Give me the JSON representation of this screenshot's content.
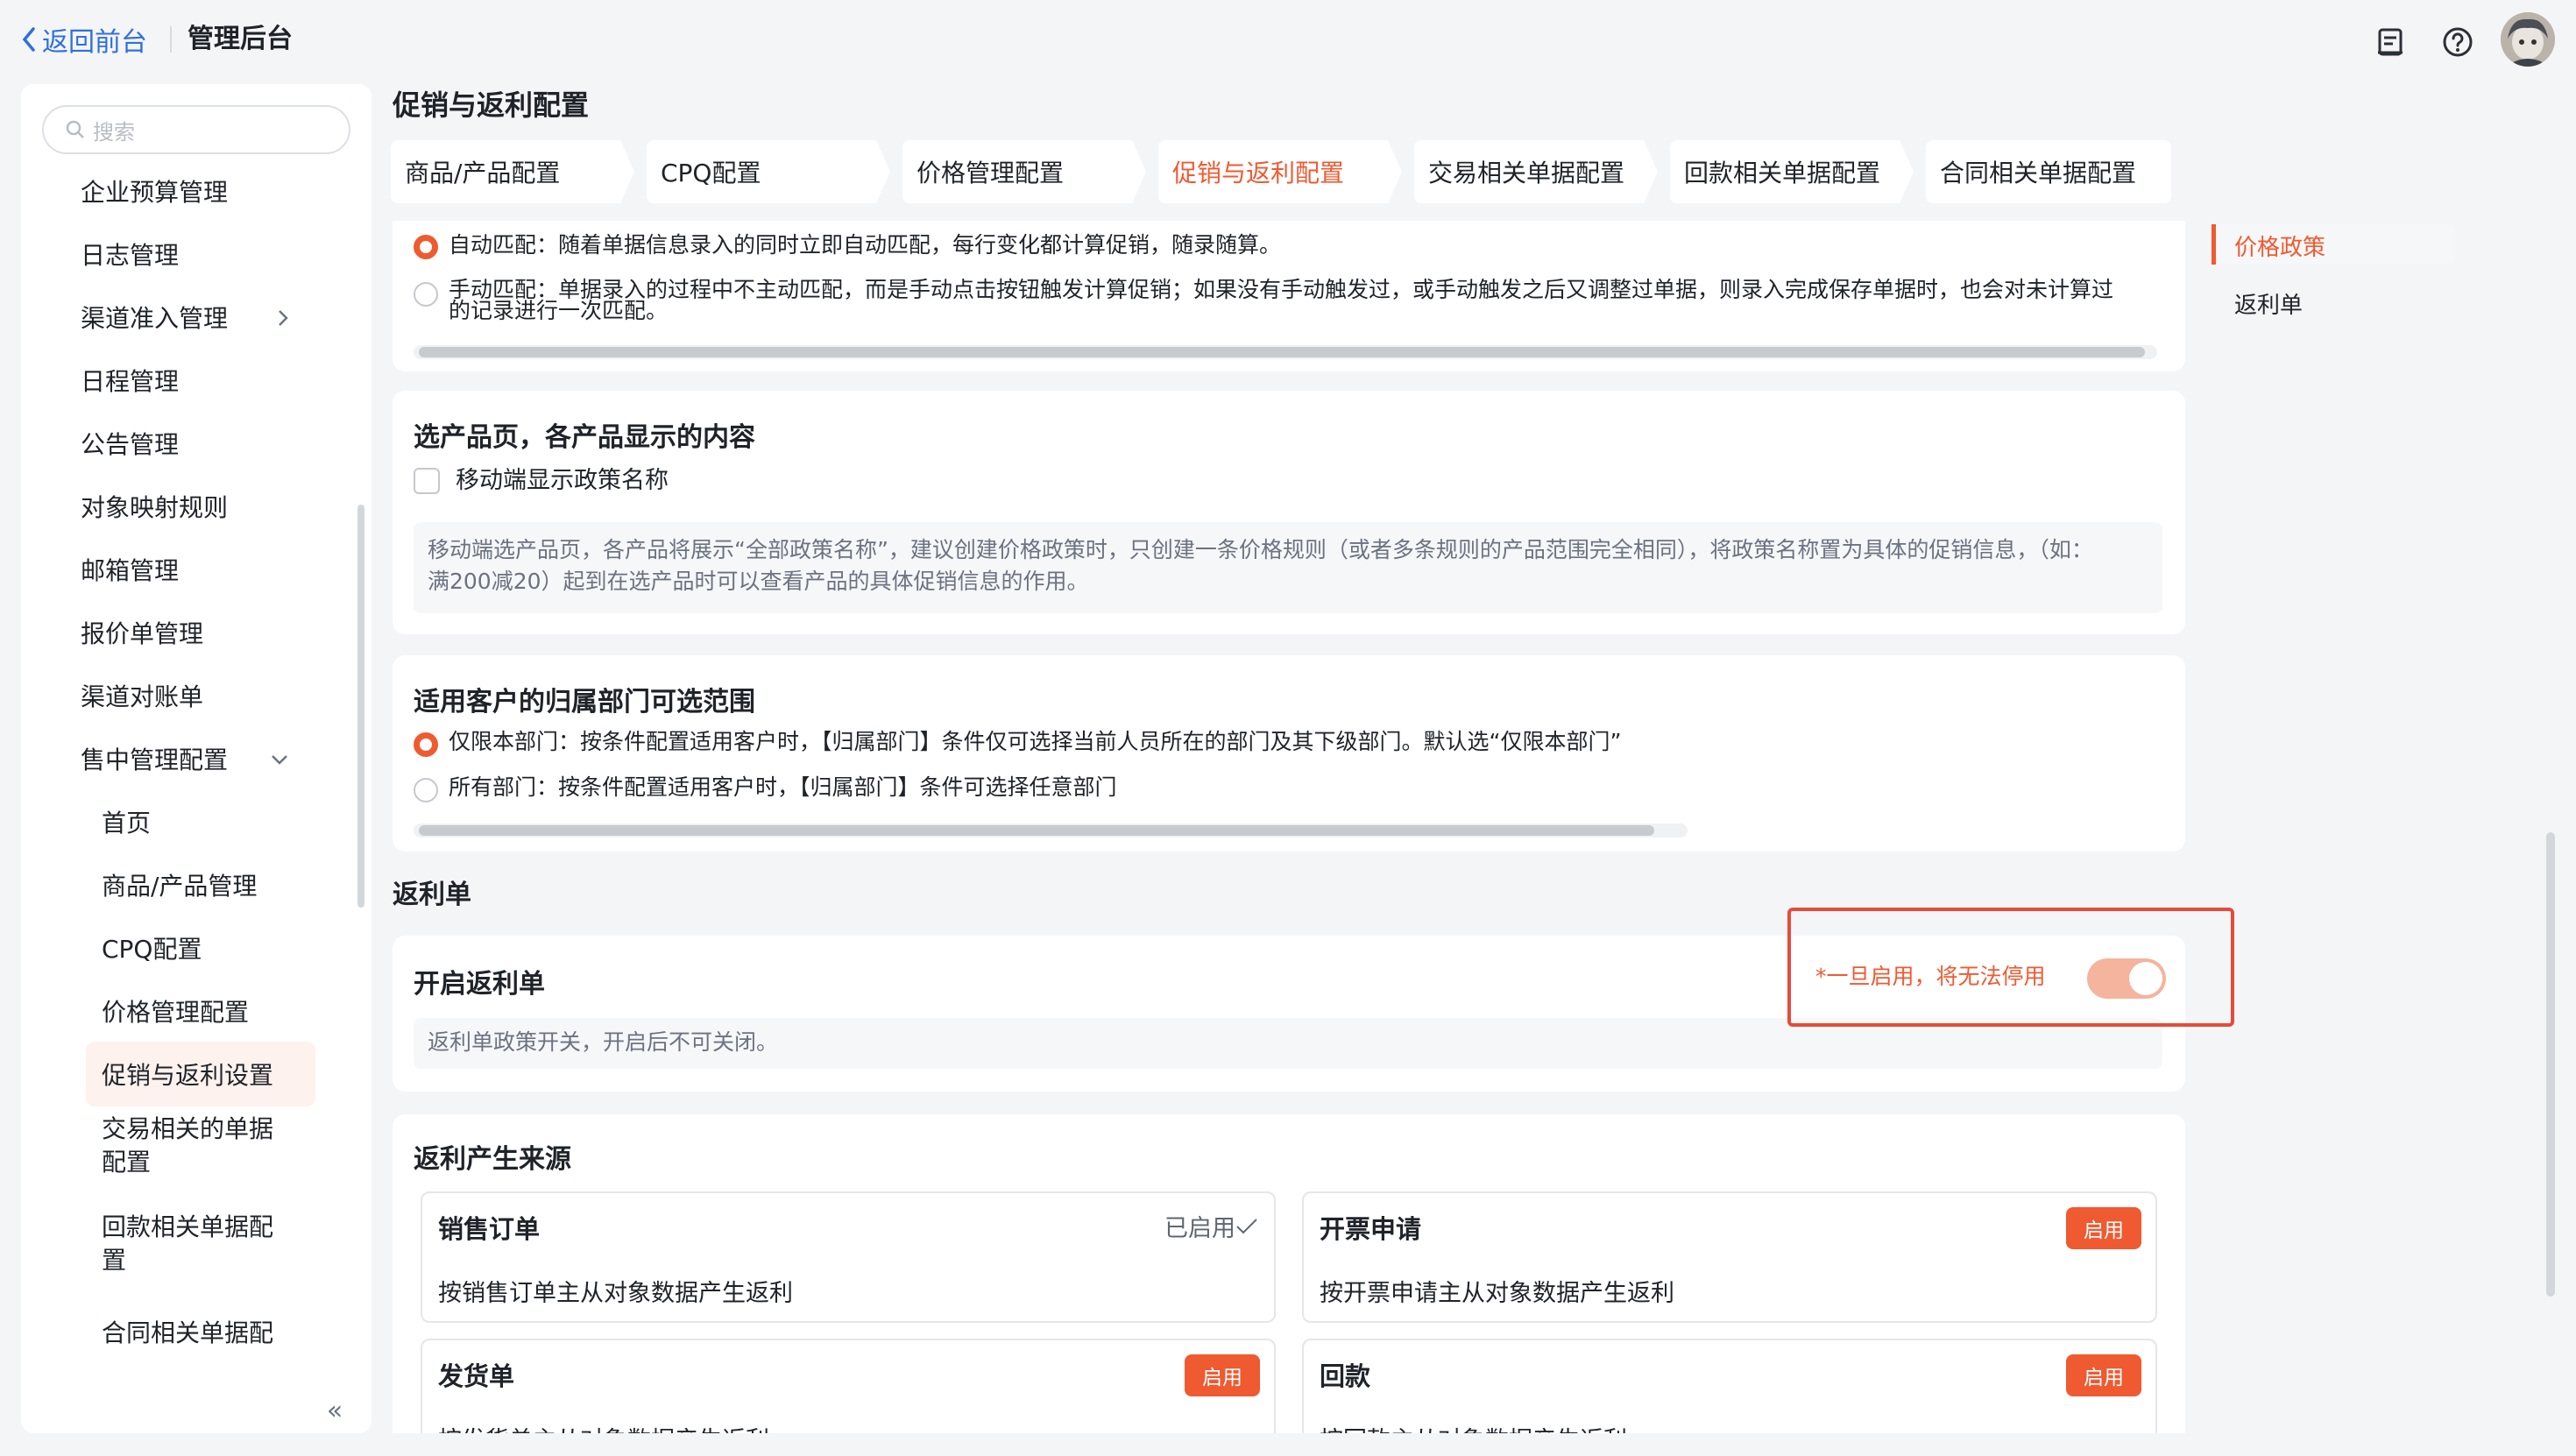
{
  "header": {
    "back_label": "返回前台",
    "title": "管理后台"
  },
  "sidebar": {
    "search_placeholder": "搜索",
    "items": [
      {
        "label": "企业预算管理"
      },
      {
        "label": "日志管理"
      },
      {
        "label": "渠道准入管理"
      },
      {
        "label": "日程管理"
      },
      {
        "label": "公告管理"
      },
      {
        "label": "对象映射规则"
      },
      {
        "label": "邮箱管理"
      },
      {
        "label": "报价单管理"
      },
      {
        "label": "渠道对账单"
      },
      {
        "label": "售中管理配置"
      }
    ],
    "sub_items": [
      {
        "label": "首页"
      },
      {
        "label": "商品/产品管理"
      },
      {
        "label": "CPQ配置"
      },
      {
        "label": "价格管理配置"
      },
      {
        "label": "促销与返利设置"
      },
      {
        "label": "交易相关的单据"
      },
      {
        "label": "配置"
      },
      {
        "label": "回款相关单据配"
      },
      {
        "label": "置"
      },
      {
        "label": "合同相关单据配"
      }
    ],
    "collapse_label": "«"
  },
  "main": {
    "page_title": "促销与返利配置",
    "tabs": [
      {
        "label": "商品/产品配置"
      },
      {
        "label": "CPQ配置"
      },
      {
        "label": "价格管理配置"
      },
      {
        "label": "促销与返利配置"
      },
      {
        "label": "交易相关单据配置"
      },
      {
        "label": "回款相关单据配置"
      },
      {
        "label": "合同相关单据配置"
      }
    ],
    "match": {
      "auto_label": "自动匹配：随着单据信息录入的同时立即自动匹配，每行变化都计算促销，随录随算。",
      "manual_label_1": "手动匹配：单据录入的过程中不主动匹配，而是手动点击按钮触发计算促销；如果没有手动触发过，或手动触发之后又调整过单据，则录入完成保存单据时，也会对未计算过",
      "manual_label_2": "的记录进行一次匹配。"
    },
    "product_page": {
      "title": "选产品页，各产品显示的内容",
      "checkbox_label": "移动端显示政策名称",
      "note_1": "移动端选产品页，各产品将展示“全部政策名称”，建议创建价格政策时，只创建一条价格规则（或者多条规则的产品范围完全相同），将政策名称置为具体的促销信息，（如：",
      "note_2": "满200减20）起到在选产品时可以查看产品的具体促销信息的作用。"
    },
    "dept_scope": {
      "title": "适用客户的归属部门可选范围",
      "own_label": "仅限本部门：按条件配置适用客户时，【归属部门】条件仅可选择当前人员所在的部门及其下级部门。默认选“仅限本部门”",
      "all_label": "所有部门：按条件配置适用客户时，【归属部门】条件可选择任意部门"
    },
    "rebate": {
      "section_title": "返利单",
      "enable_title": "开启返利单",
      "warning": "*一旦启用，将无法停用",
      "enable_note": "返利单政策开关，开启后不可关闭。",
      "sources_title": "返利产生来源",
      "sources": [
        {
          "title": "销售订单",
          "desc": "按销售订单主从对象数据产生返利",
          "status": "已启用"
        },
        {
          "title": "开票申请",
          "desc": "按开票申请主从对象数据产生返利",
          "button": "启用"
        },
        {
          "title": "发货单",
          "desc": "按发货单主从对象数据产生返利",
          "button": "启用"
        },
        {
          "title": "回款",
          "desc": "按回款主从对象数据产生返利",
          "button": "启用"
        }
      ]
    }
  },
  "anchors": [
    {
      "label": "价格政策"
    },
    {
      "label": "返利单"
    }
  ],
  "colors": {
    "accent": "#ef5a30",
    "link": "#2f6fe0",
    "highlight_border": "#e84a3a"
  }
}
